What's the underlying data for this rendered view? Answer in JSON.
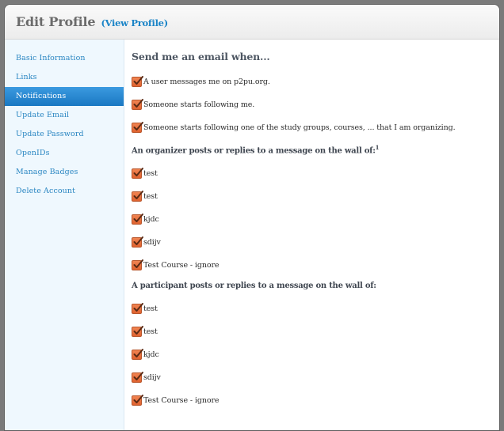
{
  "header": {
    "title": "Edit Profile",
    "view_link": "(View Profile)"
  },
  "sidebar": {
    "items": [
      {
        "label": "Basic Information",
        "active": false
      },
      {
        "label": "Links",
        "active": false
      },
      {
        "label": "Notifications",
        "active": true
      },
      {
        "label": "Update Email",
        "active": false
      },
      {
        "label": "Update Password",
        "active": false
      },
      {
        "label": "OpenIDs",
        "active": false
      },
      {
        "label": "Manage Badges",
        "active": false
      },
      {
        "label": "Delete Account",
        "active": false
      }
    ]
  },
  "main": {
    "section_title": "Send me an email when...",
    "general_options": [
      {
        "label": "A user messages me on p2pu.org.",
        "checked": true
      },
      {
        "label": "Someone starts following me.",
        "checked": true
      },
      {
        "label": "Someone starts following one of the study groups, courses, ... that I am organizing.",
        "checked": true
      }
    ],
    "organizer_title": "An organizer posts or replies to a message on the wall of:",
    "organizer_footnote": "1",
    "organizer_options": [
      {
        "label": "test",
        "checked": true
      },
      {
        "label": "test",
        "checked": true
      },
      {
        "label": "kjdc",
        "checked": true
      },
      {
        "label": "sdijv",
        "checked": true
      },
      {
        "label": "Test Course - ignore",
        "checked": true
      }
    ],
    "participant_title": "A participant posts or replies to a message on the wall of:",
    "participant_options": [
      {
        "label": "test",
        "checked": true
      },
      {
        "label": "test",
        "checked": true
      },
      {
        "label": "kjdc",
        "checked": true
      },
      {
        "label": "sdijv",
        "checked": true
      },
      {
        "label": "Test Course - ignore",
        "checked": true
      }
    ]
  },
  "colors": {
    "accent": "#1a84c7",
    "active_nav": "#2a88d0",
    "checkbox": "#e8713f",
    "sidebar_bg": "#eff8fe"
  }
}
